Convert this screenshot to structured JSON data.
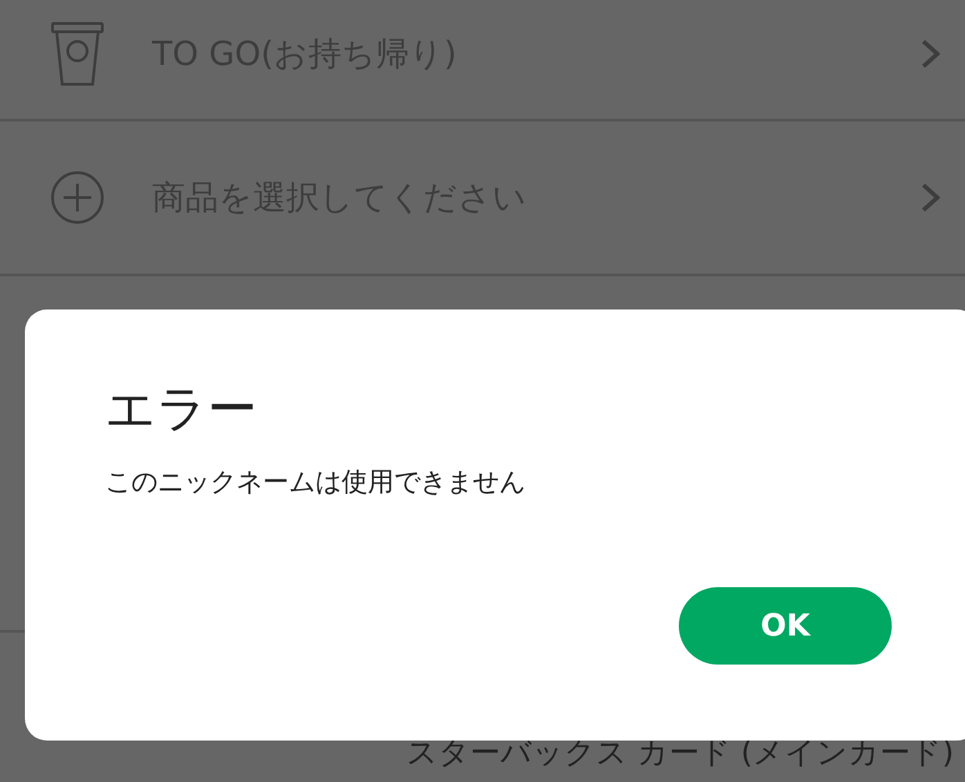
{
  "menu_rows": [
    {
      "kind": "cup",
      "label": "TO GO(お持ち帰り)"
    },
    {
      "kind": "plus",
      "label": "商品を選択してください"
    }
  ],
  "footer": {
    "card_label": "スターバックス カード (メインカード)"
  },
  "dialog": {
    "title": "エラー",
    "message": "このニックネームは使用できません",
    "button": "OK"
  }
}
